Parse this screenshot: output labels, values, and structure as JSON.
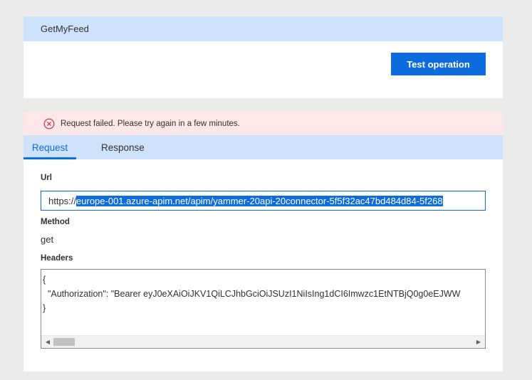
{
  "operation": {
    "name": "GetMyFeed",
    "test_button_label": "Test operation"
  },
  "error": {
    "message": "Request failed. Please try again in a few minutes."
  },
  "tabs": [
    {
      "label": "Request",
      "active": true
    },
    {
      "label": "Response",
      "active": false
    }
  ],
  "request": {
    "url_label": "Url",
    "url_prefix": "https://",
    "url_selected": "europe-001.azure-apim.net/apim/yammer-20api-20connector-5f5f32ac47bd484d84-5f268",
    "method_label": "Method",
    "method_value": "get",
    "headers_label": "Headers",
    "headers_lines": [
      "{",
      "  \"Authorization\": \"Bearer eyJ0eXAiOiJKV1QiLCJhbGciOiJSUzI1NiIsIng1dCI6Imwzc1EtNTBjQ0g0eEJWW",
      "}"
    ]
  },
  "colors": {
    "accent": "#0f6cde",
    "header_bg": "#cfe2fb",
    "error_bg": "#fde7e9",
    "error_icon": "#c4314b"
  },
  "icons": {
    "error": "error-circle-icon",
    "scroll_left": "scroll-left-icon",
    "scroll_right": "scroll-right-icon"
  }
}
